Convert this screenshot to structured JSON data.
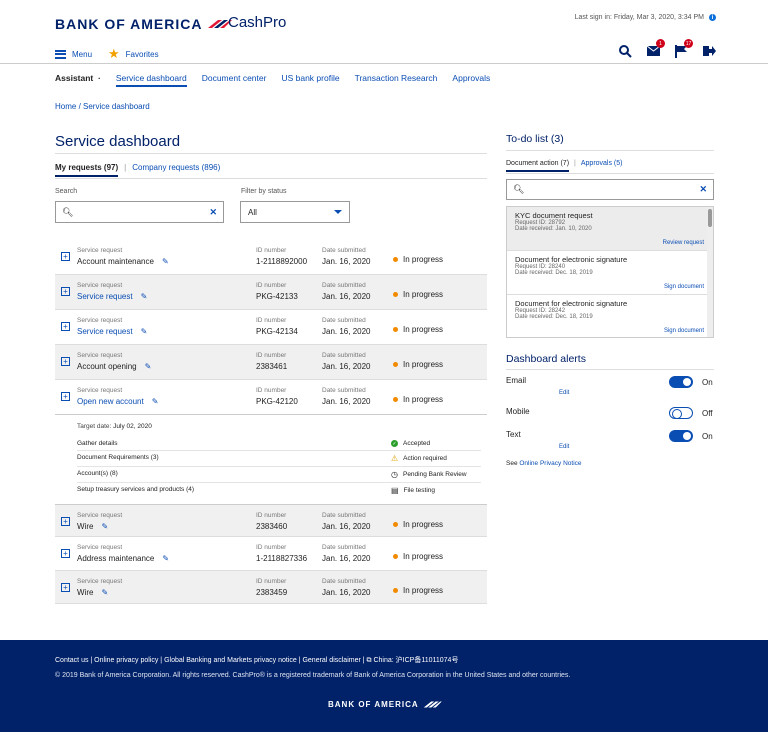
{
  "brand": {
    "name": "BANK OF AMERICA",
    "product": "CashPro",
    "footer_brand": "BANK OF AMERICA"
  },
  "header": {
    "last_signin": "Last sign in: Friday, Mar 3, 2020, 3:34 PM",
    "menu": "Menu",
    "favorites": "Favorites",
    "mail_count": "1",
    "flag_count": "17"
  },
  "nav": {
    "assistant": "Assistant",
    "items": [
      "Service dashboard",
      "Document center",
      "US bank profile",
      "Transaction Research",
      "Approvals"
    ]
  },
  "breadcrumb": "Home / Service dashboard",
  "page_title": "Service dashboard",
  "tabs": [
    "My requests (97)",
    "Company requests (896)"
  ],
  "search_label": "Search",
  "filter_label": "Filter by status",
  "filter_value": "All",
  "rows": [
    {
      "type": "Service request",
      "name": "Account maintenance",
      "id_label": "ID number",
      "id": "1-2118892000",
      "date_label": "Date submitted",
      "date": "Jan. 16, 2020",
      "status": "In progress"
    },
    {
      "type": "Service request",
      "name": "Service request",
      "id_label": "ID number",
      "id": "PKG-42133",
      "date_label": "Date submitted",
      "date": "Jan. 16, 2020",
      "status": "In progress"
    },
    {
      "type": "Service request",
      "name": "Service request",
      "id_label": "ID number",
      "id": "PKG-42134",
      "date_label": "Date submitted",
      "date": "Jan. 16, 2020",
      "status": "In progress"
    },
    {
      "type": "Service request",
      "name": "Account opening",
      "id_label": "ID number",
      "id": "2383461",
      "date_label": "Date submitted",
      "date": "Jan. 16, 2020",
      "status": "In progress"
    },
    {
      "type": "Service request",
      "name": "Open new account",
      "id_label": "ID number",
      "id": "PKG-42120",
      "date_label": "Date submitted",
      "date": "Jan. 16, 2020",
      "status": "In progress"
    }
  ],
  "detail": {
    "target_label": "Target date:",
    "target_date": "July 02, 2020",
    "items": [
      {
        "name": "Gather details",
        "status": "Accepted",
        "icon": "check-icon"
      },
      {
        "name": "Document Requirements (3)",
        "status": "Action required",
        "icon": "warning-icon"
      },
      {
        "name": "Account(s) (8)",
        "status": "Pending Bank Review",
        "icon": "clock-icon"
      },
      {
        "name": "Setup treasury services and products (4)",
        "status": "File testing",
        "icon": "document-icon"
      }
    ]
  },
  "rows2": [
    {
      "type": "Service request",
      "name": "Wire",
      "id_label": "ID number",
      "id": "2383460",
      "date_label": "Date submitted",
      "date": "Jan. 16, 2020",
      "status": "In progress"
    },
    {
      "type": "Service request",
      "name": "Address maintenance",
      "id_label": "ID number",
      "id": "1-2118827336",
      "date_label": "Date submitted",
      "date": "Jan. 16, 2020",
      "status": "In progress"
    },
    {
      "type": "Service request",
      "name": "Wire",
      "id_label": "ID number",
      "id": "2383459",
      "date_label": "Date submitted",
      "date": "Jan. 16, 2020",
      "status": "In progress"
    }
  ],
  "todo": {
    "title": "To-do list (3)",
    "tabs": [
      "Document action (7)",
      "Approvals (5)"
    ],
    "items": [
      {
        "title": "KYC document request",
        "id": "Request ID: 28792",
        "date": "Date received: Jan. 10, 2020",
        "action": "Review request"
      },
      {
        "title": "Document for electronic signature",
        "id": "Request ID: 28240",
        "date": "Date received: Dec. 18, 2019",
        "action": "Sign document"
      },
      {
        "title": "Document for electronic signature",
        "id": "Request ID: 28242",
        "date": "Date received: Dec. 18, 2019",
        "action": "Sign document"
      }
    ]
  },
  "alerts": {
    "title": "Dashboard alerts",
    "items": [
      {
        "label": "Email",
        "state": "On",
        "edit": "Edit"
      },
      {
        "label": "Mobile",
        "state": "Off",
        "edit": ""
      },
      {
        "label": "Text",
        "state": "On",
        "edit": "Edit"
      }
    ],
    "privacy_prefix": "See ",
    "privacy_link": "Online Privacy Notice"
  },
  "footer": {
    "links": "Contact us  |  Online privacy policy  |  Global Banking and Markets privacy notice  |  General disclaimer  |",
    "china": "China: 沪ICP备11011074号",
    "copyright": "© 2019 Bank of America Corporation. All rights reserved. CashPro® is a registered trademark of Bank of America Corporation in the United States and other countries."
  },
  "colors": {
    "brand_navy": "#012169",
    "link_blue": "#0a4db3",
    "status_orange": "#f28a00",
    "alert_red": "#d0021b"
  }
}
